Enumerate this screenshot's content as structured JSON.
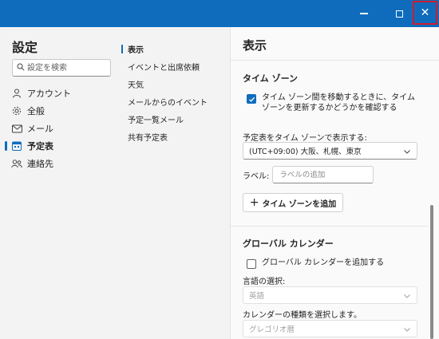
{
  "window": {
    "minimize_label": "Minimize",
    "maximize_label": "Maximize",
    "close_glyph": "✕"
  },
  "sidebar": {
    "title": "設定",
    "search_placeholder": "設定を検索",
    "items": [
      {
        "label": "アカウント",
        "icon": "person-icon"
      },
      {
        "label": "全般",
        "icon": "gear-icon"
      },
      {
        "label": "メール",
        "icon": "mail-icon"
      },
      {
        "label": "予定表",
        "icon": "calendar-icon",
        "active": true
      },
      {
        "label": "連絡先",
        "icon": "people-icon"
      }
    ]
  },
  "subnav": {
    "items": [
      {
        "label": "表示",
        "active": true
      },
      {
        "label": "イベントと出席依頼"
      },
      {
        "label": "天気"
      },
      {
        "label": "メールからのイベント"
      },
      {
        "label": "予定一覧メール"
      },
      {
        "label": "共有予定表"
      }
    ]
  },
  "pane": {
    "title": "表示",
    "timezone": {
      "heading": "タイム ゾーン",
      "confirm_checkbox": {
        "text": "タイム ゾーン間を移動するときに、タイム ゾーンを更新するかどうかを確認する",
        "checked": true
      },
      "display_label": "予定表をタイム ゾーンで表示する:",
      "display_value": "(UTC+09:00) 大阪、札幌、東京",
      "label_caption": "ラベル:",
      "label_placeholder": "ラベルの追加",
      "add_button": "タイム ゾーンを追加"
    },
    "global_calendar": {
      "heading": "グローバル カレンダー",
      "add_checkbox": {
        "text": "グローバル カレンダーを追加する",
        "checked": false
      },
      "language_label": "言語の選択:",
      "language_value": "英語",
      "type_label": "カレンダーの種類を選択します。",
      "type_value": "グレゴリオ暦"
    }
  },
  "colors": {
    "accent": "#0f6cbd",
    "close_highlight": "#d01c2c"
  }
}
